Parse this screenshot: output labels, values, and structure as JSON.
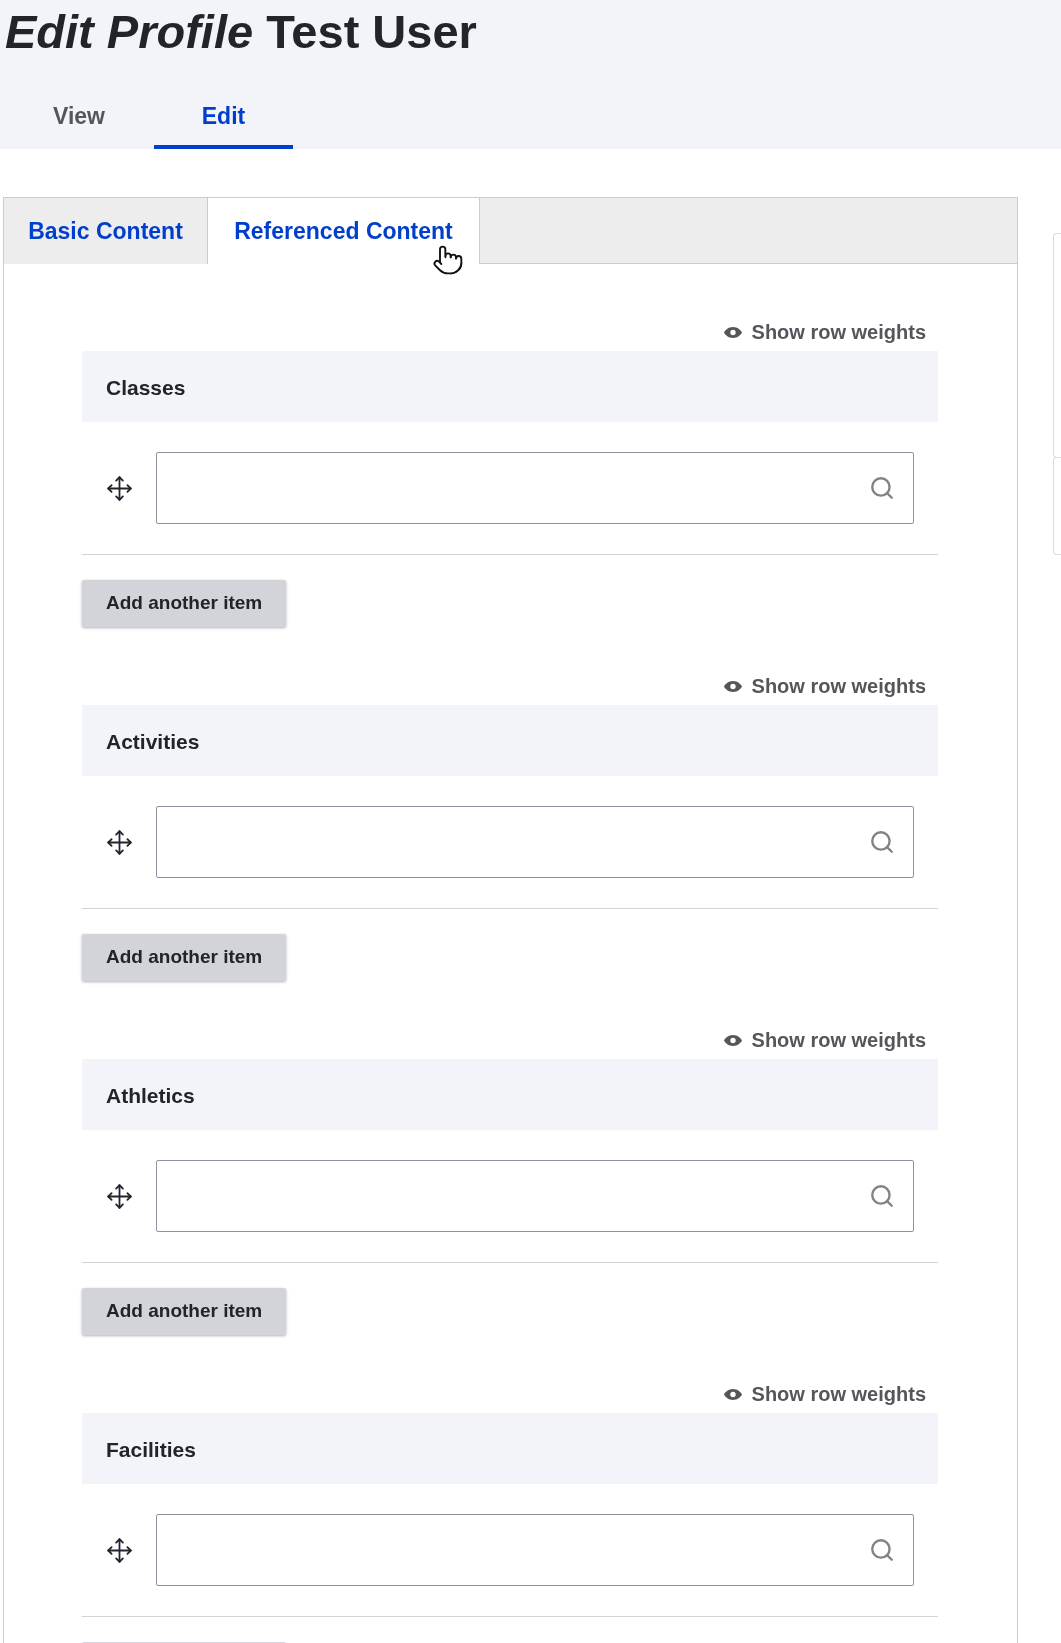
{
  "page_title": "*Edit Profile* Test User",
  "primary_tabs": [
    {
      "label": "View",
      "selected": false
    },
    {
      "label": "Edit",
      "selected": true
    }
  ],
  "form_tabs": [
    {
      "label": "Basic Content",
      "selected": false,
      "hovered": false
    },
    {
      "label": "Referenced Content",
      "selected": true,
      "hovered": true
    }
  ],
  "fields": [
    {
      "weights_toggle": "Show row weights",
      "label": "Classes",
      "add_button": "Add another item"
    },
    {
      "weights_toggle": "Show row weights",
      "label": "Activities",
      "add_button": "Add another item"
    },
    {
      "weights_toggle": "Show row weights",
      "label": "Athletics",
      "add_button": "Add another item"
    },
    {
      "weights_toggle": "Show row weights",
      "label": "Facilities"
    }
  ]
}
